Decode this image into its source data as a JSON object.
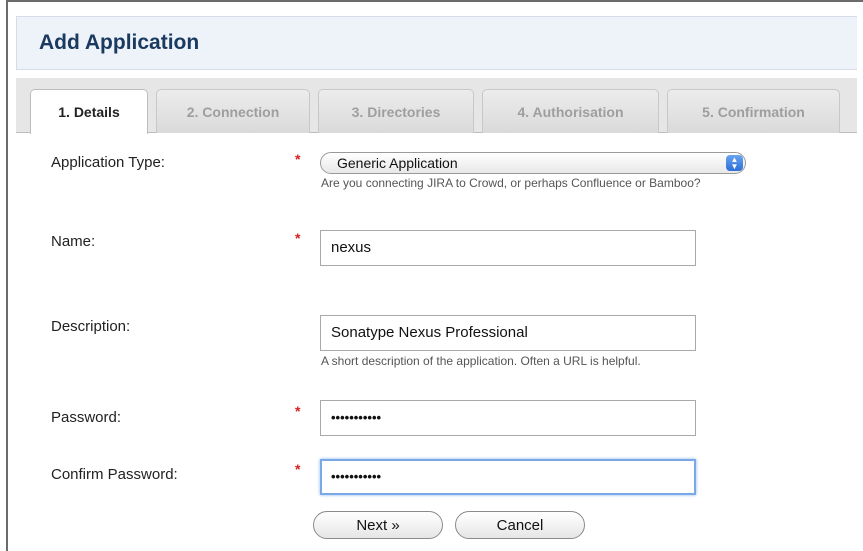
{
  "page": {
    "title": "Add Application"
  },
  "tabs": [
    {
      "label": "1. Details",
      "active": true
    },
    {
      "label": "2. Connection",
      "active": false
    },
    {
      "label": "3. Directories",
      "active": false
    },
    {
      "label": "4. Authorisation",
      "active": false
    },
    {
      "label": "5. Confirmation",
      "active": false
    }
  ],
  "form": {
    "required_marker": "*",
    "application_type": {
      "label": "Application Type:",
      "selected": "Generic Application",
      "help": "Are you connecting JIRA to Crowd, or perhaps Confluence or Bamboo?"
    },
    "name": {
      "label": "Name:",
      "value": "nexus"
    },
    "description": {
      "label": "Description:",
      "value": "Sonatype Nexus Professional",
      "help": "A short description of the application. Often a URL is helpful."
    },
    "password": {
      "label": "Password:",
      "value": "•••••••••••"
    },
    "confirm_password": {
      "label": "Confirm Password:",
      "value": "•••••••••••"
    }
  },
  "buttons": {
    "next": "Next »",
    "cancel": "Cancel"
  },
  "colors": {
    "title": "#1a3a60",
    "required": "#d62020",
    "select_arrow": "#2d6fd6"
  }
}
